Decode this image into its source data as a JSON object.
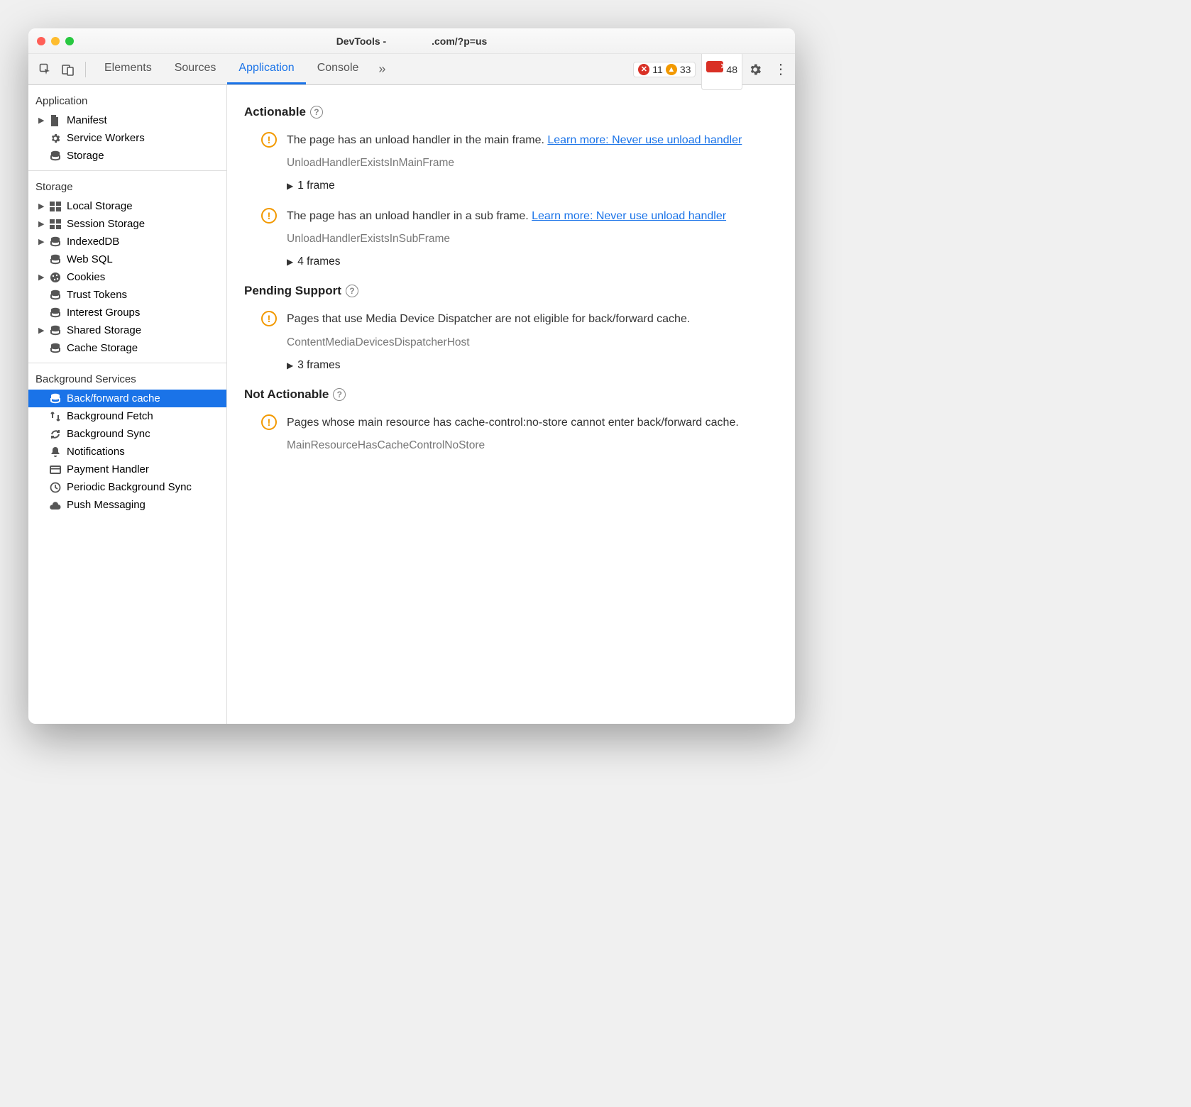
{
  "title": {
    "prefix": "DevTools - ",
    "suffix": ".com/?p=us"
  },
  "toolbar": {
    "tabs": [
      "Elements",
      "Sources",
      "Application",
      "Console"
    ],
    "errors": "11",
    "warnings": "33",
    "issues": "48"
  },
  "sidebar": {
    "application": {
      "heading": "Application",
      "items": [
        "Manifest",
        "Service Workers",
        "Storage"
      ]
    },
    "storage": {
      "heading": "Storage",
      "items": [
        "Local Storage",
        "Session Storage",
        "IndexedDB",
        "Web SQL",
        "Cookies",
        "Trust Tokens",
        "Interest Groups",
        "Shared Storage",
        "Cache Storage"
      ]
    },
    "bg": {
      "heading": "Background Services",
      "items": [
        "Back/forward cache",
        "Background Fetch",
        "Background Sync",
        "Notifications",
        "Payment Handler",
        "Periodic Background Sync",
        "Push Messaging"
      ]
    }
  },
  "sections": {
    "actionable": {
      "title": "Actionable",
      "issues": [
        {
          "msg": "The page has an unload handler in the main frame. ",
          "link": "Learn more: Never use unload handler",
          "code": "UnloadHandlerExistsInMainFrame",
          "frames": "1 frame"
        },
        {
          "msg": "The page has an unload handler in a sub frame. ",
          "link": "Learn more: Never use unload handler",
          "code": "UnloadHandlerExistsInSubFrame",
          "frames": "4 frames"
        }
      ]
    },
    "pending": {
      "title": "Pending Support",
      "issues": [
        {
          "msg": "Pages that use Media Device Dispatcher are not eligible for back/forward cache.",
          "code": "ContentMediaDevicesDispatcherHost",
          "frames": "3 frames"
        }
      ]
    },
    "notactionable": {
      "title": "Not Actionable",
      "issues": [
        {
          "msg": "Pages whose main resource has cache-control:no-store cannot enter back/forward cache.",
          "code": "MainResourceHasCacheControlNoStore"
        }
      ]
    }
  }
}
